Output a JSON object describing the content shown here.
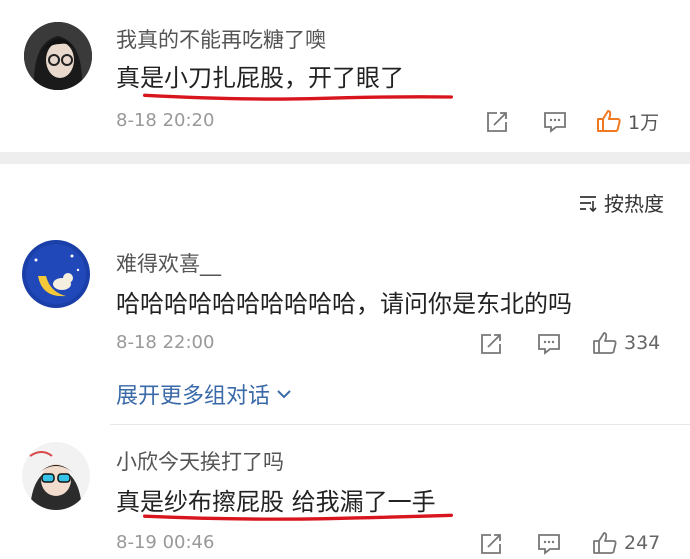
{
  "comments": [
    {
      "username": "我真的不能再吃糖了噢",
      "content": "真是小刀扎屁股，开了眼了",
      "time": "8-18 20:20",
      "likes": "1万"
    },
    {
      "username": "难得欢喜__",
      "content": "哈哈哈哈哈哈哈哈哈哈，请问你是东北的吗",
      "time": "8-18 22:00",
      "likes": "334"
    },
    {
      "username": "小欣今天挨打了吗",
      "content": "真是纱布擦屁股 给我漏了一手",
      "time": "8-19 00:46",
      "likes": "247"
    }
  ],
  "sort_label": "按热度",
  "expand_label": "展开更多组对话",
  "colors": {
    "underline": "#d8141c",
    "like_active": "#f07a22",
    "link": "#3a6aa8"
  },
  "icons": [
    "share-icon",
    "comment-icon",
    "like-icon",
    "sort-icon",
    "chevron-down-icon"
  ]
}
